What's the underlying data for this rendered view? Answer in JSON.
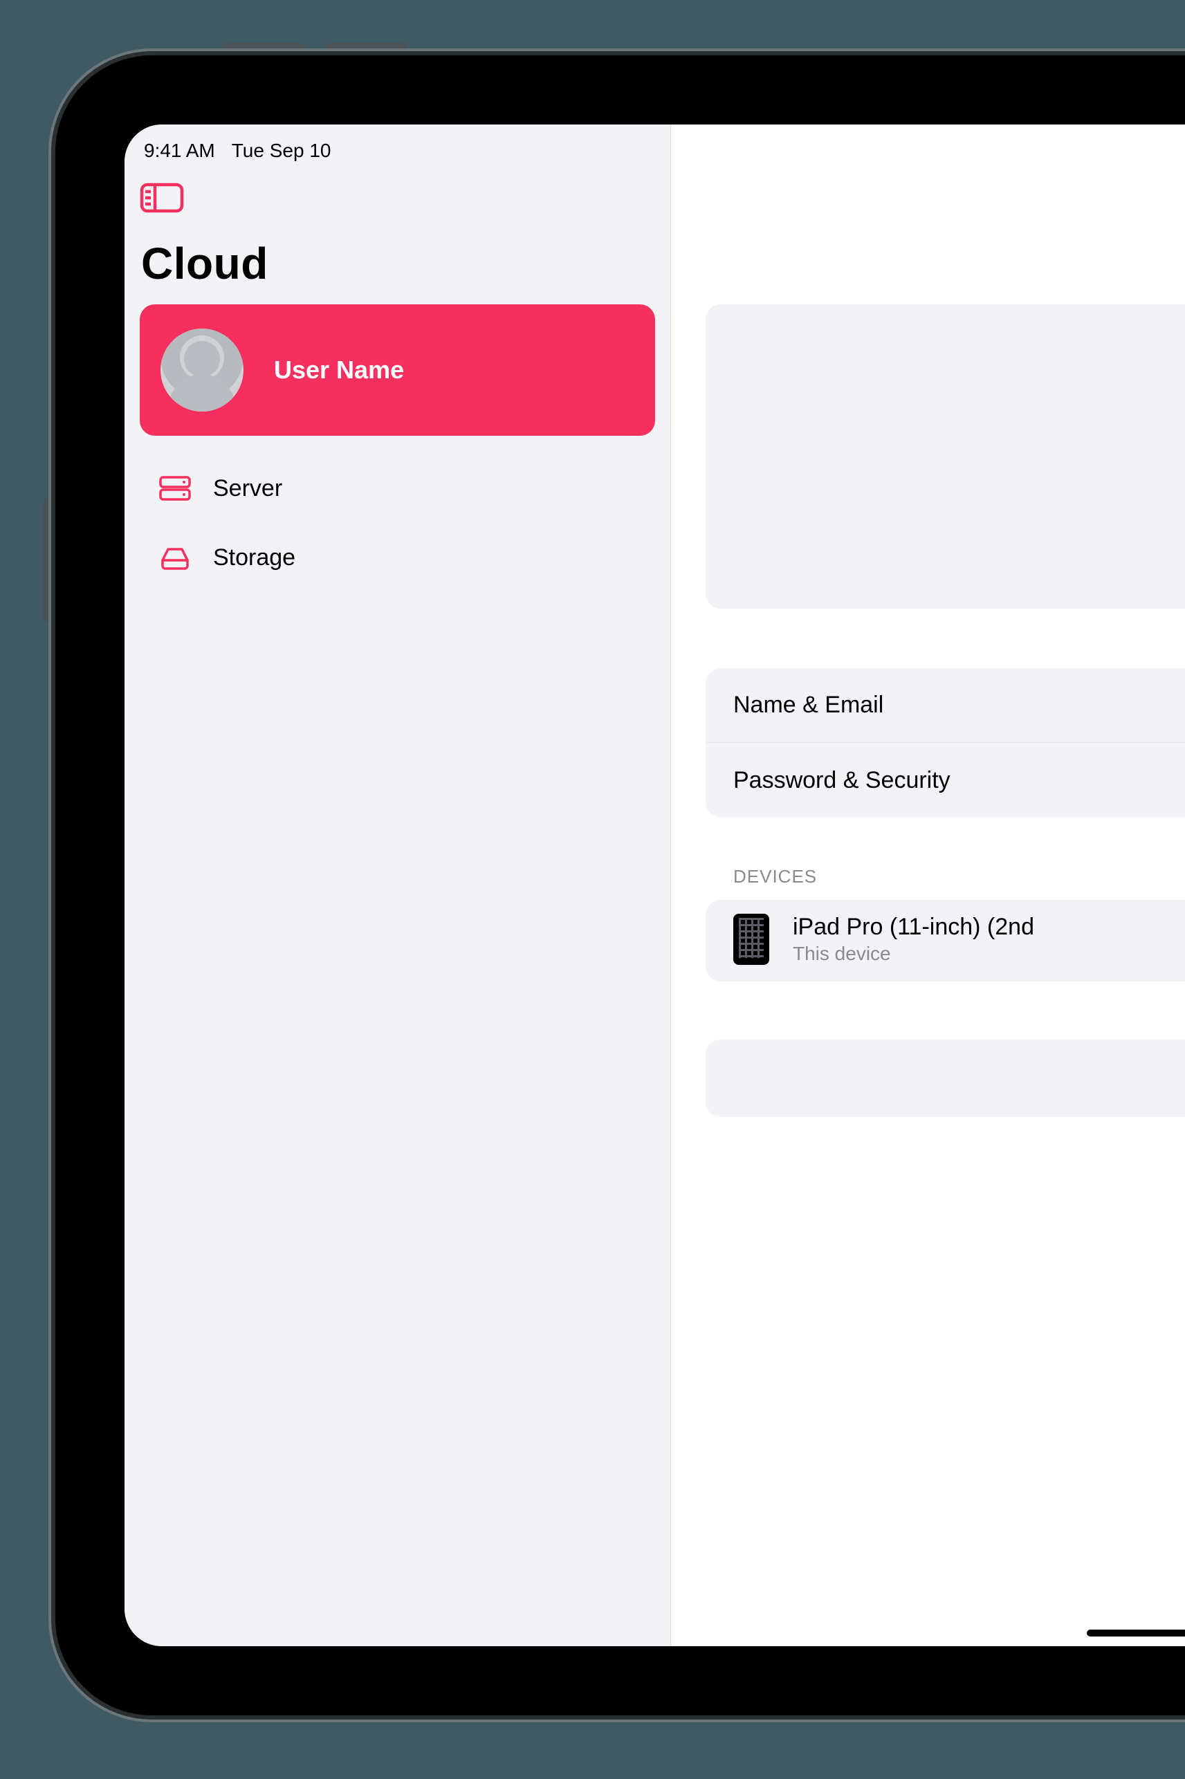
{
  "status": {
    "time": "9:41 AM",
    "date": "Tue Sep 10"
  },
  "sidebar": {
    "title": "Cloud",
    "user": {
      "name": "User Name"
    },
    "items": [
      {
        "icon": "server-icon",
        "label": "Server"
      },
      {
        "icon": "storage-icon",
        "label": "Storage"
      }
    ]
  },
  "detail": {
    "rows": [
      {
        "label": "Name & Email"
      },
      {
        "label": "Password & Security"
      }
    ],
    "devices_header": "DEVICES",
    "devices": [
      {
        "name": "iPad Pro (11-inch) (2nd",
        "subtitle": "This device"
      }
    ]
  }
}
